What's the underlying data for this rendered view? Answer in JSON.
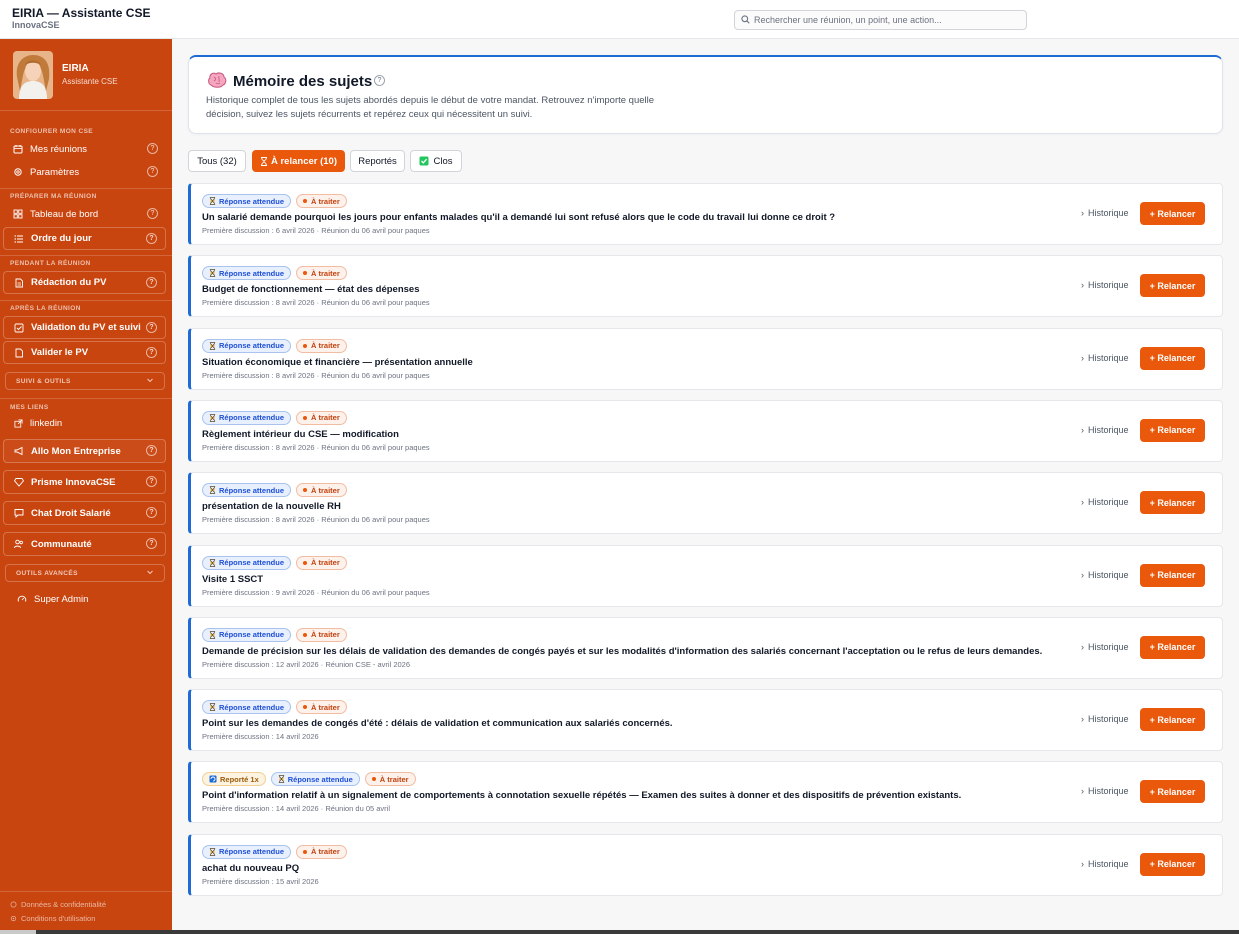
{
  "app": {
    "title": "EIRIA — Assistante CSE",
    "subtitle": "InnovaCSE"
  },
  "search": {
    "placeholder": "Rechercher une réunion, un point, une action..."
  },
  "profile": {
    "name": "EIRIA",
    "role": "Assistante CSE"
  },
  "sidebar": {
    "configurer_label": "CONFIGURER MON CSE",
    "mes_reunions": "Mes réunions",
    "parametres": "Paramètres",
    "preparer_label": "PRÉPARER MA RÉUNION",
    "tableau_de_bord": "Tableau de bord",
    "ordre_du_jour": "Ordre du jour",
    "pendant_label": "PENDANT LA RÉUNION",
    "redaction_pv": "Rédaction du PV",
    "apres_label": "APRÈS LA RÉUNION",
    "validation_pv": "Validation du PV et suivi",
    "valider_pv": "Valider le PV",
    "suivi_outils": "SUIVI & OUTILS",
    "mes_liens_label": "MES LIENS",
    "linkedin": "linkedin",
    "allo": "Allo Mon Entreprise",
    "prisme": "Prisme InnovaCSE",
    "chat_droit": "Chat Droit Salarié",
    "communaute": "Communauté",
    "outils_avances": "OUTILS AVANCÉS",
    "super_admin": "Super Admin",
    "help_glyph": "?",
    "donnees": "Données & confidentialité",
    "conditions": "Conditions d'utilisation"
  },
  "header": {
    "title": "Mémoire des sujets",
    "help_glyph": "?",
    "description": "Historique complet de tous les sujets abordés depuis le début de votre mandat. Retrouvez n'importe quelle décision, suivez les sujets récurrents et repérez ceux qui nécessitent un suivi."
  },
  "tabs": [
    {
      "label": "Tous (32)"
    },
    {
      "label": "À relancer (10)"
    },
    {
      "label": "Reportés"
    },
    {
      "label": "Clos"
    }
  ],
  "labels": {
    "reponse_attendue": "Réponse attendue",
    "a_traiter": "À traiter",
    "historique": "Historique",
    "relancer": "+ Relancer"
  },
  "items": [
    {
      "title": "Un salarié demande pourquoi les jours pour enfants malades qu'il a demandé lui sont refusé alors que le code du travail lui donne ce droit ?",
      "meta": "Première discussion : 6 avril 2026 · Réunion du 06 avril pour paques"
    },
    {
      "title": "Budget de fonctionnement — état des dépenses",
      "meta": "Première discussion : 8 avril 2026 · Réunion du 06 avril pour paques"
    },
    {
      "title": "Situation économique et financière — présentation annuelle",
      "meta": "Première discussion : 8 avril 2026 · Réunion du 06 avril pour paques"
    },
    {
      "title": "Règlement intérieur du CSE — modification",
      "meta": "Première discussion : 8 avril 2026 · Réunion du 06 avril pour paques"
    },
    {
      "title": "présentation de la nouvelle RH",
      "meta": "Première discussion : 8 avril 2026 · Réunion du 06 avril pour paques"
    },
    {
      "title": "Visite 1 SSCT",
      "meta": "Première discussion : 9 avril 2026 · Réunion du 06 avril pour paques"
    },
    {
      "title": "Demande de précision sur les délais de validation des demandes de congés payés et sur les modalités d'information des salariés concernant l'acceptation ou le refus de leurs demandes.",
      "meta": "Première discussion : 12 avril 2026 · Réunion CSE - avril 2026"
    },
    {
      "title": "Point sur les demandes de congés d'été : délais de validation et communication aux salariés concernés.",
      "meta": "Première discussion : 14 avril 2026"
    },
    {
      "reported": "Reporté 1x",
      "title": "Point d'information relatif à un signalement de comportements à connotation sexuelle répétés — Examen des suites à donner et des dispositifs de prévention existants.",
      "meta": "Première discussion : 14 avril 2026 · Réunion du 05 avril"
    },
    {
      "title": "achat du nouveau PQ",
      "meta": "Première discussion : 15 avril 2026"
    }
  ],
  "icons": {
    "search": "search-icon",
    "brain": "brain-icon",
    "hourglass": "hourglass-icon",
    "check": "check-box-icon",
    "calendar": "calendar-icon",
    "gear": "gear-icon",
    "grid": "grid-icon",
    "list": "list-icon",
    "document": "document-icon",
    "chevron_down": "chevron-down-icon"
  },
  "colors": {
    "sidebar": "#c9450f",
    "accent": "#ea580c",
    "blue": "#1e6bd6"
  }
}
